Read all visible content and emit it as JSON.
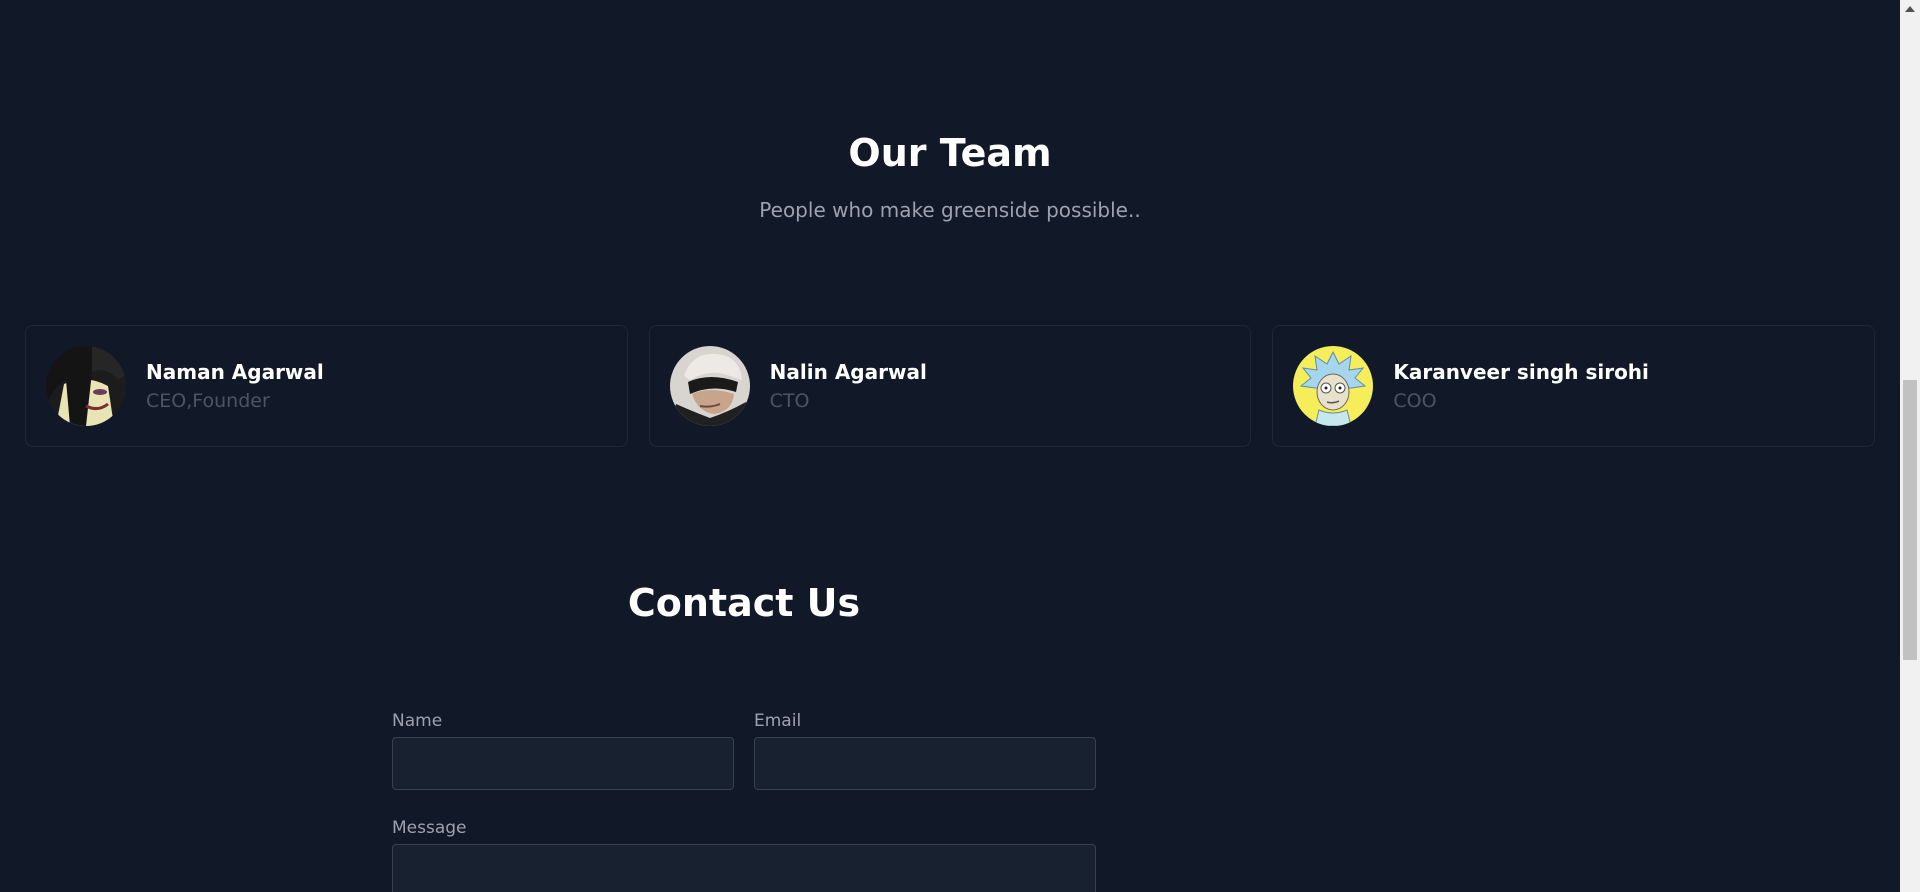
{
  "team": {
    "title": "Our Team",
    "subtitle": "People who make greenside possible..",
    "members": [
      {
        "name": "Naman Agarwal",
        "role": "CEO,Founder",
        "avatar": "dark-haired-character-avatar"
      },
      {
        "name": "Nalin Agarwal",
        "role": "CTO",
        "avatar": "blindfolded-character-avatar"
      },
      {
        "name": "Karanveer singh sirohi",
        "role": "COO",
        "avatar": "blue-haired-scientist-avatar"
      }
    ]
  },
  "contact": {
    "title": "Contact Us",
    "name_label": "Name",
    "name_value": "",
    "email_label": "Email",
    "email_value": "",
    "message_label": "Message",
    "message_value": ""
  },
  "colors": {
    "background": "#111827",
    "card_border": "#1f2937",
    "input_background": "#182130",
    "input_border": "#374151",
    "heading": "#ffffff",
    "muted_text": "#9ca3af",
    "role_text": "#4b5563"
  }
}
